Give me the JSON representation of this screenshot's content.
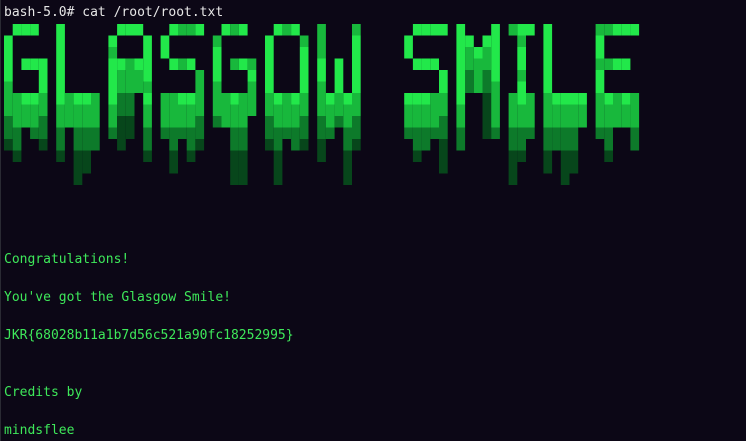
{
  "terminal": {
    "prompt": "bash-5.0#",
    "command": "cat /root/root.txt",
    "banner_text": "GLASGOW SMILE",
    "colors": {
      "background": "#0c0716",
      "text_green": "#3ee85a",
      "bright_green": "#22e84a",
      "mid_green": "#18b83c",
      "dark_green": "#0d7a2a",
      "darkest_green": "#07461b"
    },
    "output": {
      "congrats": "Congratulations!",
      "got": "You've got the Glasgow Smile!",
      "flag": "JKR{68028b11a1b7d56c521a90fc18252995}",
      "credits": "Credits by",
      "author": "mindsflee"
    }
  }
}
